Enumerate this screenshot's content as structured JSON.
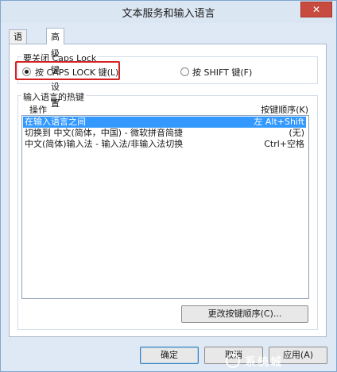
{
  "window": {
    "title": "文本服务和输入语言",
    "close_label": "✕"
  },
  "tabs": [
    {
      "label": "语言栏",
      "active": false
    },
    {
      "label": "高级键设置",
      "active": true
    }
  ],
  "caps_lock_group": {
    "label": "要关闭 Caps Lock",
    "options": [
      {
        "label": "按 CAPS LOCK 键(L)",
        "checked": true
      },
      {
        "label": "按 SHIFT 键(F)",
        "checked": false
      }
    ]
  },
  "hotkeys_group": {
    "label": "输入语言的热键",
    "column_action": "操作",
    "column_sequence": "按键顺序(K)",
    "rows": [
      {
        "action": "在输入语言之间",
        "sequence": "左 Alt+Shift",
        "selected": true
      },
      {
        "action": "切换到 中文(简体，中国) - 微软拼音简捷",
        "sequence": "(无)",
        "selected": false
      },
      {
        "action": "中文(简体)输入法 - 输入法/非输入法切换",
        "sequence": "Ctrl+空格",
        "selected": false
      }
    ],
    "change_button": "更改按键顺序(C)..."
  },
  "footer": {
    "ok": "确定",
    "cancel": "取消",
    "apply": "应用(A)"
  },
  "watermark": "系统城",
  "colors": {
    "highlight_box": "#d32020",
    "selection": "#3399ff",
    "close_button": "#c74b3f"
  }
}
